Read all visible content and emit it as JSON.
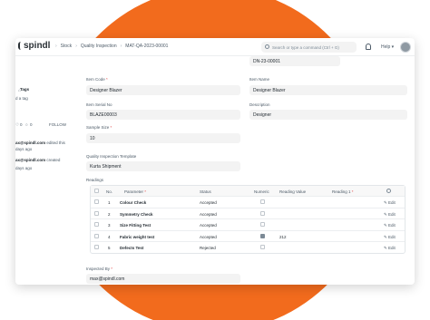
{
  "brand": {
    "name": "spindl",
    "accent": "#f26b1d"
  },
  "breadcrumb": [
    "Stock",
    "Quality Inspection",
    "MAT-QA-2023-00001"
  ],
  "search": {
    "placeholder": "Search or type a command (Ctrl + G)"
  },
  "nav": {
    "help_label": "Help",
    "bell_icon": "bell-icon",
    "avatar_icon": "avatar"
  },
  "sidebar": {
    "tags_label": "Tags",
    "add_tag": "d a tag",
    "likes": "0",
    "comments": "0",
    "follow": "FOLLOW",
    "activity": [
      {
        "user": "ax@spindl.com",
        "action": "edited this",
        "time": "days ago"
      },
      {
        "user": "ax@spindl.com",
        "action": "created",
        "time": "days ago"
      }
    ]
  },
  "form": {
    "top_right_value": "DN-23-00001",
    "item_code": {
      "label": "Item Code",
      "value": "Designer Blazer"
    },
    "item_name": {
      "label": "Item Name",
      "value": "Designer Blazer"
    },
    "item_serial_no": {
      "label": "Item Serial No",
      "value": "BLAZE00003"
    },
    "description": {
      "label": "Description",
      "value": "Designer"
    },
    "sample_size": {
      "label": "Sample Size",
      "value": "10"
    },
    "qi_template": {
      "label": "Quality Inspection Template",
      "value": "Kurta Shipment"
    },
    "readings_label": "Readings",
    "inspected_by": {
      "label": "Inspected By",
      "value": "max@spindl.com"
    }
  },
  "readings": {
    "columns": [
      "No.",
      "Parameter",
      "Status",
      "Numeric",
      "Reading Value",
      "Reading 1"
    ],
    "edit_label": "Edit",
    "rows": [
      {
        "no": "1",
        "parameter": "Colour Check",
        "status": "Accepted",
        "numeric": false,
        "reading_value": ""
      },
      {
        "no": "2",
        "parameter": "Symmetry Check",
        "status": "Accepted",
        "numeric": false,
        "reading_value": ""
      },
      {
        "no": "3",
        "parameter": "Size Fitting Test",
        "status": "Accepted",
        "numeric": false,
        "reading_value": ""
      },
      {
        "no": "4",
        "parameter": "Fabric weight test",
        "status": "Accepted",
        "numeric": true,
        "reading_value": "212"
      },
      {
        "no": "5",
        "parameter": "Defects Test",
        "status": "Rejected",
        "numeric": false,
        "reading_value": ""
      }
    ]
  }
}
